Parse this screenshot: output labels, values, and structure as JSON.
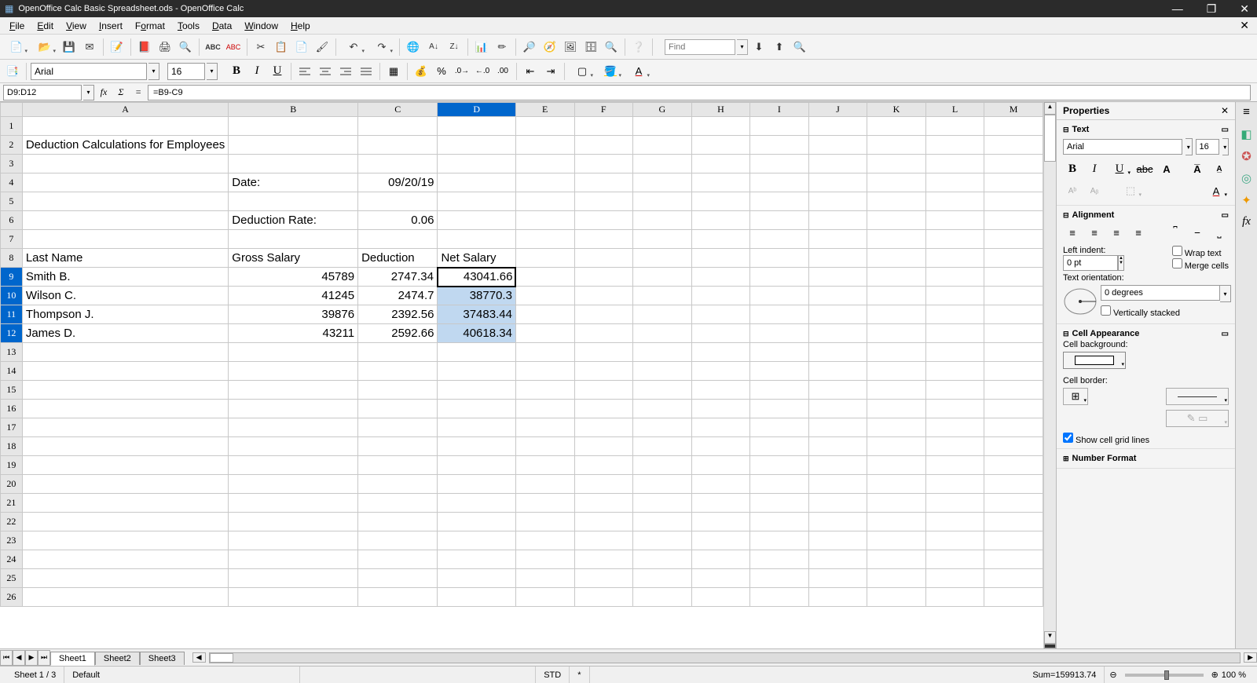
{
  "titlebar": {
    "title": "OpenOffice Calc Basic Spreadsheet.ods - OpenOffice Calc"
  },
  "menu": {
    "file": "File",
    "edit": "Edit",
    "view": "View",
    "insert": "Insert",
    "format": "Format",
    "tools": "Tools",
    "data": "Data",
    "window": "Window",
    "help": "Help"
  },
  "toolbar": {
    "find_placeholder": "Find"
  },
  "fmt": {
    "font": "Arial",
    "size": "16"
  },
  "formula": {
    "name_box": "D9:D12",
    "formula": "=B9-C9"
  },
  "columns": [
    "A",
    "B",
    "C",
    "D",
    "E",
    "F",
    "G",
    "H",
    "I",
    "J",
    "K",
    "L",
    "M"
  ],
  "rows": 26,
  "cells": {
    "A2": {
      "v": "Deduction Calculations for Employees",
      "t": "text"
    },
    "B4": {
      "v": "Date:",
      "t": "text"
    },
    "C4": {
      "v": "09/20/19",
      "t": "num"
    },
    "B6": {
      "v": "Deduction Rate:",
      "t": "text"
    },
    "C6": {
      "v": "0.06",
      "t": "num"
    },
    "A8": {
      "v": "Last Name",
      "t": "text"
    },
    "B8": {
      "v": "Gross Salary",
      "t": "text"
    },
    "C8": {
      "v": "Deduction",
      "t": "text"
    },
    "D8": {
      "v": "Net Salary",
      "t": "text"
    },
    "A9": {
      "v": "Smith B.",
      "t": "text"
    },
    "B9": {
      "v": "45789",
      "t": "num"
    },
    "C9": {
      "v": "2747.34",
      "t": "num"
    },
    "D9": {
      "v": "43041.66",
      "t": "num",
      "active": true
    },
    "A10": {
      "v": "Wilson C.",
      "t": "text"
    },
    "B10": {
      "v": "41245",
      "t": "num"
    },
    "C10": {
      "v": "2474.7",
      "t": "num"
    },
    "D10": {
      "v": "38770.3",
      "t": "num",
      "sel": true
    },
    "A11": {
      "v": "Thompson J.",
      "t": "text"
    },
    "B11": {
      "v": "39876",
      "t": "num"
    },
    "C11": {
      "v": "2392.56",
      "t": "num"
    },
    "D11": {
      "v": "37483.44",
      "t": "num",
      "sel": true
    },
    "A12": {
      "v": "James D.",
      "t": "text"
    },
    "B12": {
      "v": "43211",
      "t": "num"
    },
    "C12": {
      "v": "2592.66",
      "t": "num"
    },
    "D12": {
      "v": "40618.34",
      "t": "num",
      "sel": true
    }
  },
  "selected_rows": [
    9,
    10,
    11,
    12
  ],
  "selected_cols": [
    "D"
  ],
  "tabs": {
    "sheets": [
      "Sheet1",
      "Sheet2",
      "Sheet3"
    ],
    "active": 0
  },
  "status": {
    "sheet": "Sheet 1 / 3",
    "style": "Default",
    "mode": "STD",
    "star": "*",
    "sum": "Sum=159913.74",
    "zoom": "100 %"
  },
  "sidebar": {
    "title": "Properties",
    "text_section": "Text",
    "font": "Arial",
    "size": "16",
    "alignment_section": "Alignment",
    "left_indent_label": "Left indent:",
    "left_indent": "0 pt",
    "wrap": "Wrap text",
    "merge": "Merge cells",
    "orient_label": "Text orientation:",
    "orient": "0 degrees",
    "vstacked": "Vertically stacked",
    "cellapp_section": "Cell Appearance",
    "cellbg": "Cell background:",
    "cellborder": "Cell border:",
    "gridlines": "Show cell grid lines",
    "numfmt_section": "Number Format"
  }
}
